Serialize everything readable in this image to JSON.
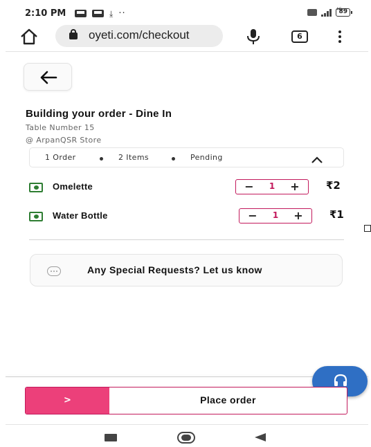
{
  "status_bar": {
    "time": "2:10 PM",
    "network": "4G",
    "battery": "89"
  },
  "browser": {
    "url": "oyeti.com/checkout",
    "tab_count": "6"
  },
  "order": {
    "title": "Building your order - Dine In",
    "table": "Table Number 15",
    "store": "@ ArpanQSR Store",
    "summary": {
      "orders": "1 Order",
      "items": "2 Items",
      "status": "Pending"
    },
    "items": [
      {
        "name": "Omelette",
        "qty": "1",
        "price": "₹2"
      },
      {
        "name": "Water Bottle",
        "qty": "1",
        "price": "₹1"
      }
    ]
  },
  "special_requests": {
    "placeholder": "Any Special Requests? Let us know"
  },
  "checkout": {
    "arrow": ">",
    "place_order_label": "Place order"
  },
  "stepper": {
    "minus": "−",
    "plus": "+"
  },
  "colors": {
    "accent": "#c2185b",
    "accent_fill": "#ec407a",
    "support_fab": "#2f6fc4",
    "veg_green": "#2e7d32"
  }
}
